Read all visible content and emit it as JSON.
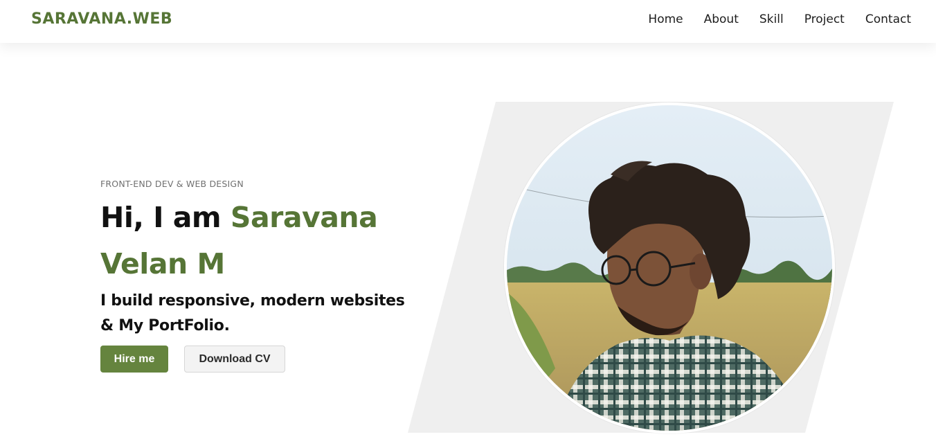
{
  "header": {
    "logo": "SARAVANA.WEB",
    "nav": [
      "Home",
      "About",
      "Skill",
      "Project",
      "Contact"
    ]
  },
  "hero": {
    "tagline": "FRONT-END DEV & WEB DESIGN",
    "greeting": "Hi, I am ",
    "name": "Saravana Velan M",
    "subtitle_line1": "I build responsive, modern websites",
    "subtitle_line2": "& My PortFolio.",
    "hire_button": "Hire me",
    "cv_button": "Download CV"
  },
  "colors": {
    "brand_green": "#567536",
    "button_green": "#65843e",
    "panel_gray": "#efefef"
  },
  "icons": {
    "avatar": "profile-photo"
  }
}
